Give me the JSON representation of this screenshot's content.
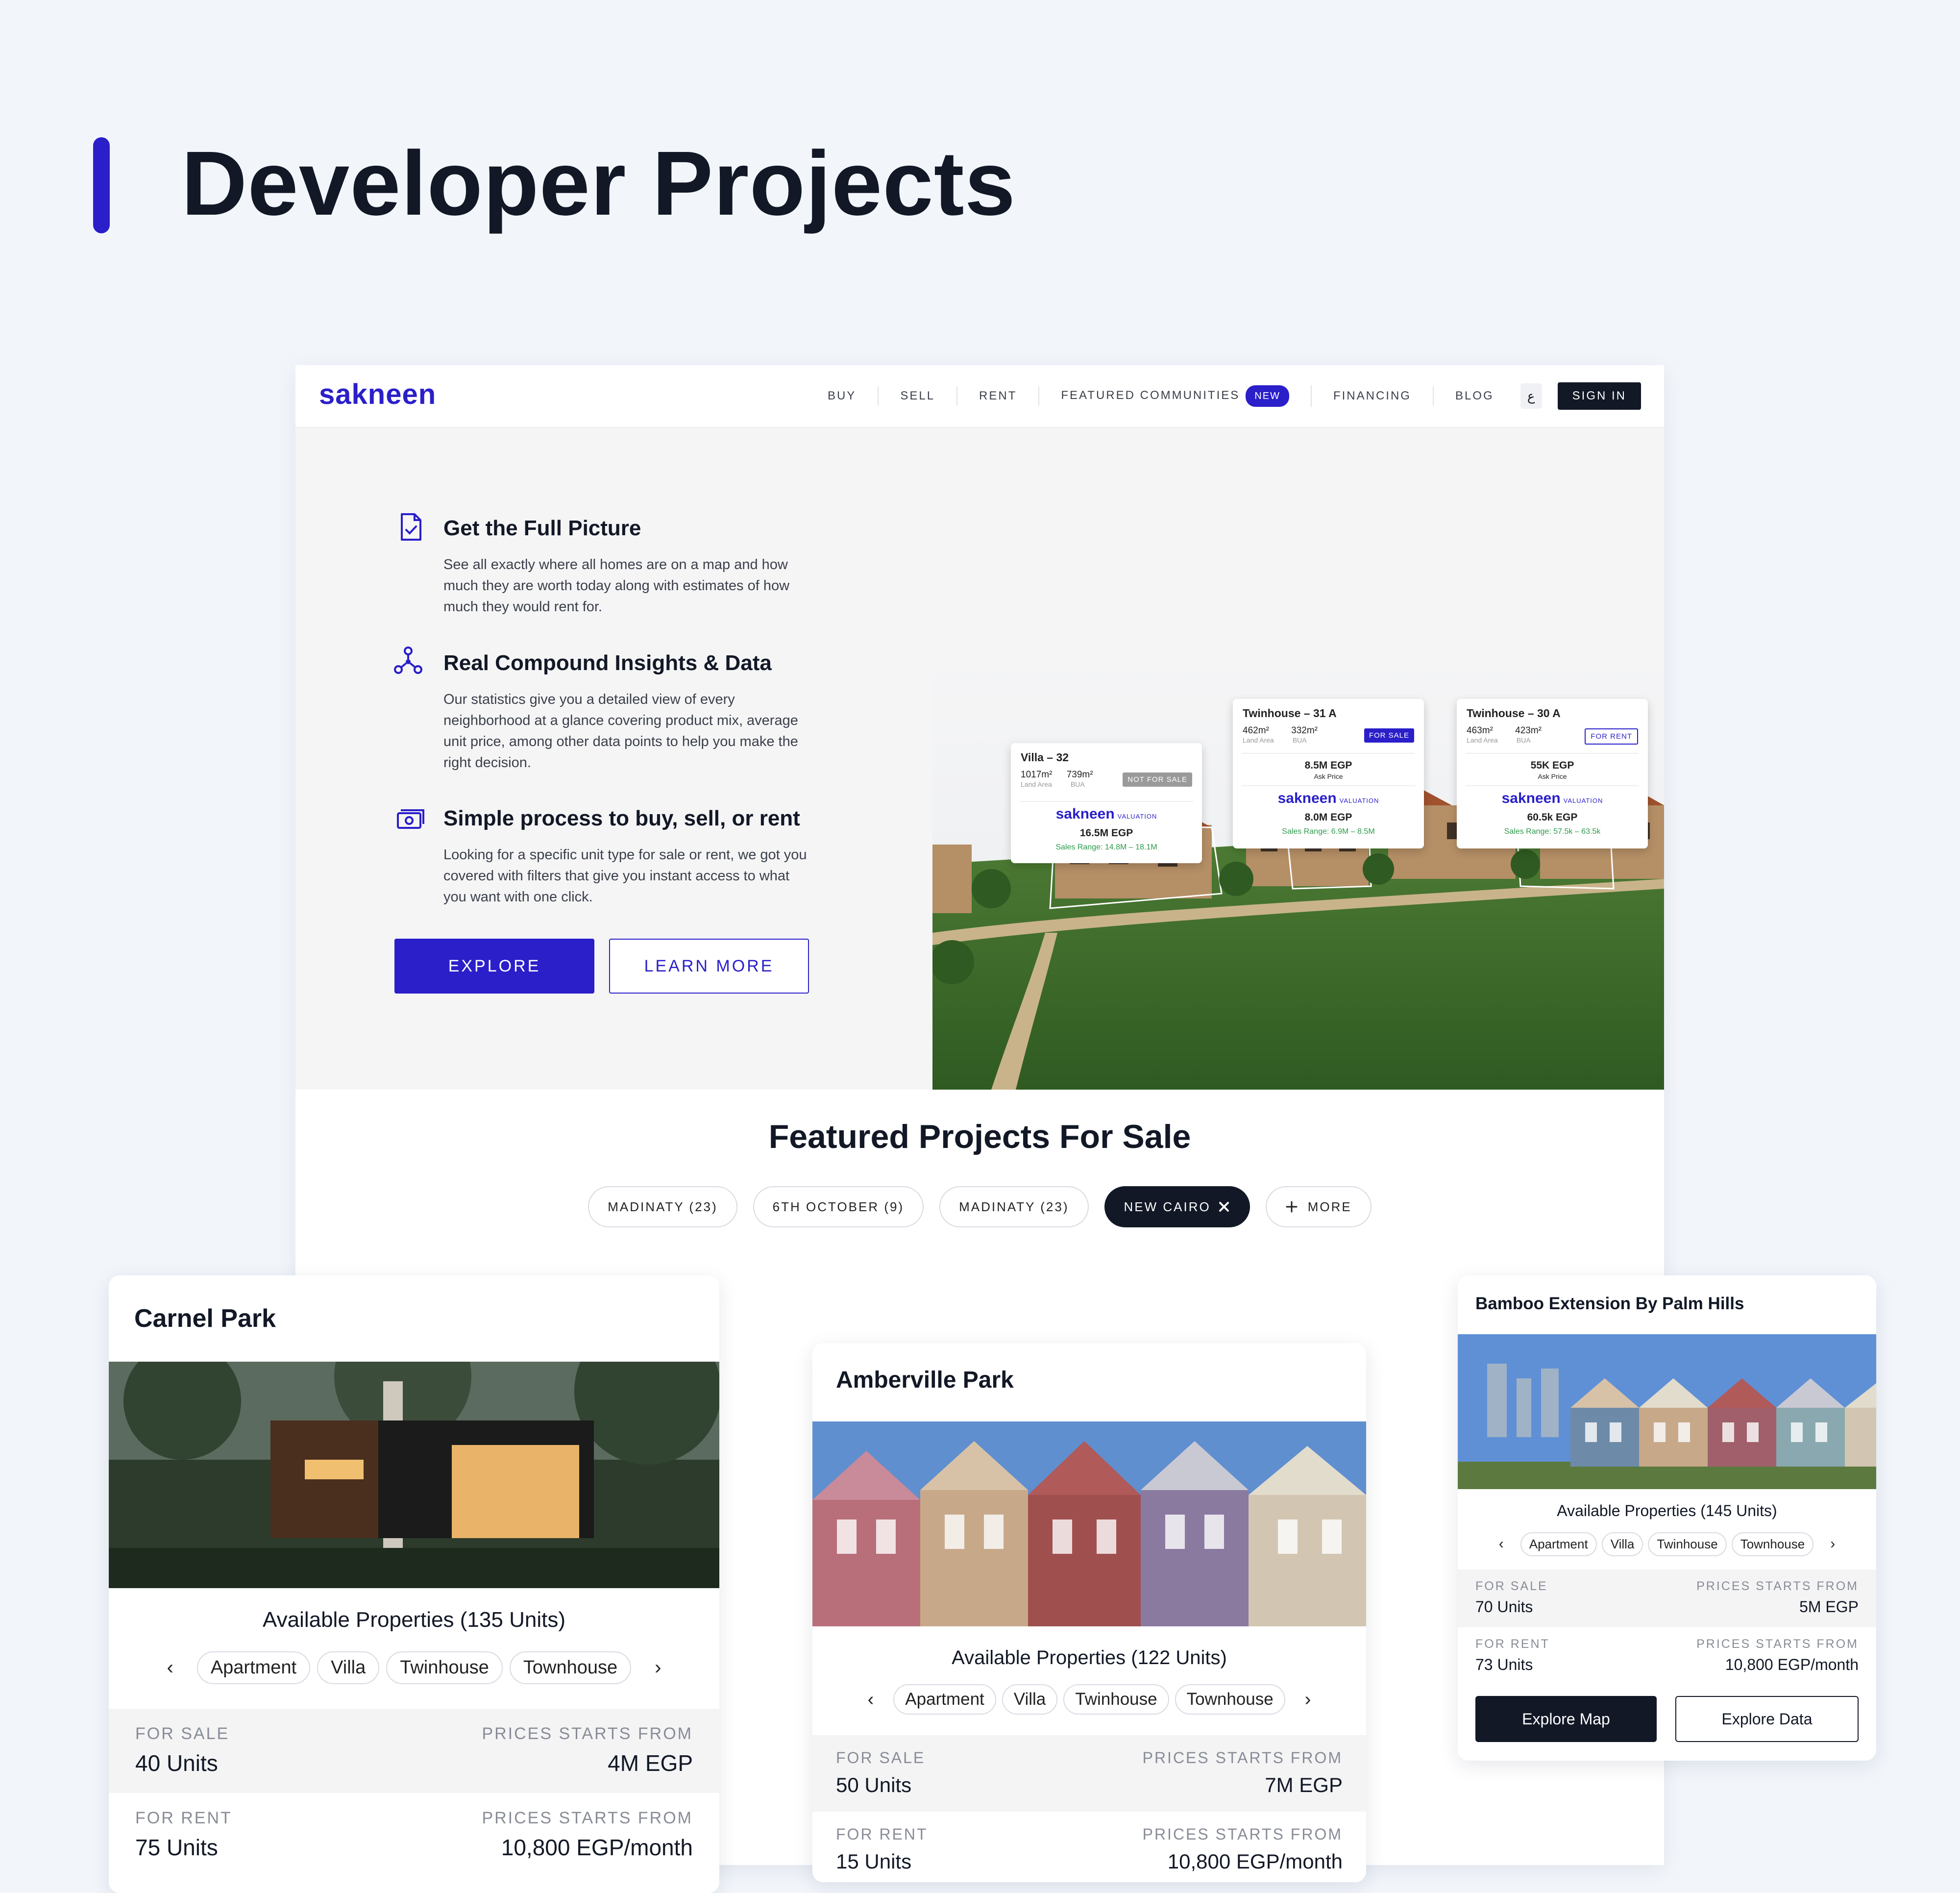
{
  "page": {
    "title": "Developer Projects"
  },
  "colors": {
    "accent": "#2a1fc9",
    "dark": "#121826",
    "background": "#f2f6fb"
  },
  "nav": {
    "logo": "sakneen",
    "items": [
      "BUY",
      "SELL",
      "RENT",
      "FEATURED COMMUNITIES",
      "FINANCING",
      "BLOG"
    ],
    "new_badge": "NEW",
    "lang": "ع",
    "signin": "SIGN IN"
  },
  "hero": {
    "features": [
      {
        "icon": "document-check-icon",
        "title": "Get the Full Picture",
        "lines": [
          "See all exactly where all homes are on a map and how",
          "much they are worth today along with estimates of how",
          "much they would rent for."
        ]
      },
      {
        "icon": "network-nodes-icon",
        "title": "Real Compound Insights & Data",
        "lines": [
          "Our statistics give you a detailed view of every",
          "neighborhood at a glance covering product mix, average",
          "unit price, among other data points to help you make the",
          "right decision."
        ]
      },
      {
        "icon": "cash-icon",
        "title": "Simple process to buy, sell, or rent",
        "lines": [
          "Looking for a specific unit type for sale or rent, we got you",
          "covered with filters that give you instant access to what",
          "you want with one click."
        ]
      }
    ],
    "explore": "EXPLORE",
    "learn_more": "LEARN MORE",
    "callouts": [
      {
        "title": "Villa – 32",
        "land": "1017m²",
        "bua": "739m²",
        "land_label": "Land Area",
        "bua_label": "BUA",
        "tag": "NOT FOR SALE",
        "ask": "",
        "ask_label": "",
        "valuation_price": "16.5M EGP",
        "range": "Sales Range: 14.8M – 18.1M"
      },
      {
        "title": "Twinhouse – 31 A",
        "land": "462m²",
        "bua": "332m²",
        "land_label": "Land Area",
        "bua_label": "BUA",
        "tag": "FOR SALE",
        "ask": "8.5M EGP",
        "ask_label": "Ask Price",
        "valuation_price": "8.0M EGP",
        "range": "Sales Range: 6.9M – 8.5M"
      },
      {
        "title": "Twinhouse – 30 A",
        "land": "463m²",
        "bua": "423m²",
        "land_label": "Land Area",
        "bua_label": "BUA",
        "tag": "FOR RENT",
        "ask": "55K EGP",
        "ask_label": "Ask Price",
        "valuation_price": "60.5k EGP",
        "range": "Sales Range: 57.5k – 63.5k"
      }
    ],
    "valuation_logo": "sakneen",
    "valuation_word": "VALUATION"
  },
  "featured": {
    "title": "Featured Projects For Sale",
    "chips": [
      "MADINATY (23)",
      "6TH OCTOBER (9)",
      "MADINATY (23)",
      "NEW CAIRO",
      "MORE"
    ]
  },
  "cards": [
    {
      "title": "Carnel Park",
      "available": "Available Properties (135 Units)",
      "types": [
        "Apartment",
        "Villa",
        "Twinhouse",
        "Townhouse"
      ],
      "sale_label": "FOR SALE",
      "sale_units": "40 Units",
      "sale_price_label": "PRICES STARTS FROM",
      "sale_price": "4M EGP",
      "rent_label": "FOR RENT",
      "rent_units": "75 Units",
      "rent_price_label": "PRICES STARTS FROM",
      "rent_price": "10,800 EGP/month"
    },
    {
      "title": "Amberville Park",
      "available": "Available Properties (122 Units)",
      "types": [
        "Apartment",
        "Villa",
        "Twinhouse",
        "Townhouse"
      ],
      "sale_label": "FOR SALE",
      "sale_units": "50 Units",
      "sale_price_label": "PRICES STARTS FROM",
      "sale_price": "7M EGP",
      "rent_label": "FOR RENT",
      "rent_units": "15 Units",
      "rent_price_label": "PRICES STARTS FROM",
      "rent_price": "10,800 EGP/month"
    },
    {
      "title": "Bamboo Extension By Palm Hills",
      "available": "Available Properties (145 Units)",
      "types": [
        "Apartment",
        "Villa",
        "Twinhouse",
        "Townhouse"
      ],
      "sale_label": "FOR SALE",
      "sale_units": "70 Units",
      "sale_price_label": "PRICES STARTS FROM",
      "sale_price": "5M EGP",
      "rent_label": "FOR RENT",
      "rent_units": "73 Units",
      "rent_price_label": "PRICES STARTS FROM",
      "rent_price": "10,800 EGP/month",
      "explore_map": "Explore Map",
      "explore_data": "Explore Data"
    }
  ]
}
